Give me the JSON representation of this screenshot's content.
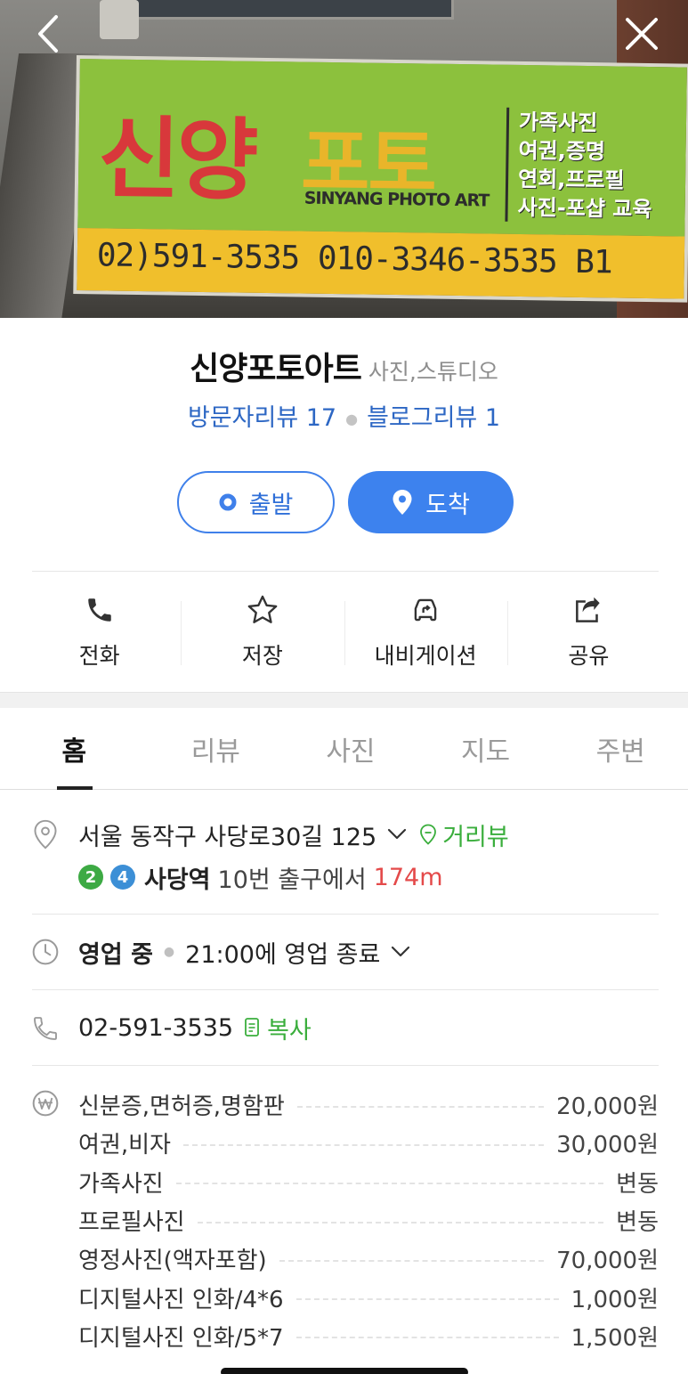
{
  "hero": {
    "sign_name_left": "신양",
    "sign_name_right": "포토",
    "sign_english": "SINYANG PHOTO ART",
    "sign_services": [
      "가족사진",
      "여권,증명",
      "연회,프로필",
      "사진-포샵 교육"
    ],
    "sign_phone": "02)591-3535   010-3346-3535  B1"
  },
  "place": {
    "name": "신양포토아트",
    "category": "사진,스튜디오",
    "visitor_reviews": "방문자리뷰 17",
    "blog_reviews": "블로그리뷰 1"
  },
  "route": {
    "start_label": "출발",
    "arrive_label": "도착"
  },
  "actions": [
    {
      "label": "전화",
      "icon": "phone-icon"
    },
    {
      "label": "저장",
      "icon": "star-icon"
    },
    {
      "label": "내비게이션",
      "icon": "navigation-icon"
    },
    {
      "label": "공유",
      "icon": "share-icon"
    }
  ],
  "tabs": [
    "홈",
    "리뷰",
    "사진",
    "지도",
    "주변"
  ],
  "address": {
    "text": "서울 동작구 사당로30길 125",
    "street_view": "거리뷰",
    "line2": "2",
    "line4": "4",
    "station": "사당역",
    "exit": "10번 출구에서",
    "distance": "174m"
  },
  "hours": {
    "status": "영업 중",
    "detail": "21:00에 영업 종료"
  },
  "phone": {
    "number": "02-591-3535",
    "copy_label": "복사"
  },
  "menu": [
    {
      "name": "신분증,면허증,명함판",
      "price": "20,000원"
    },
    {
      "name": "여권,비자",
      "price": "30,000원"
    },
    {
      "name": "가족사진",
      "price": "변동"
    },
    {
      "name": "프로필사진",
      "price": "변동"
    },
    {
      "name": "영정사진(액자포함)",
      "price": "70,000원"
    },
    {
      "name": "디지털사진 인화/4*6",
      "price": "1,000원"
    },
    {
      "name": "디지털사진 인화/5*7",
      "price": "1,500원"
    }
  ],
  "colors": {
    "accent_blue": "#3d82ee",
    "link_blue": "#2d67c4",
    "green": "#3aae3c",
    "red": "#e44a4a"
  }
}
